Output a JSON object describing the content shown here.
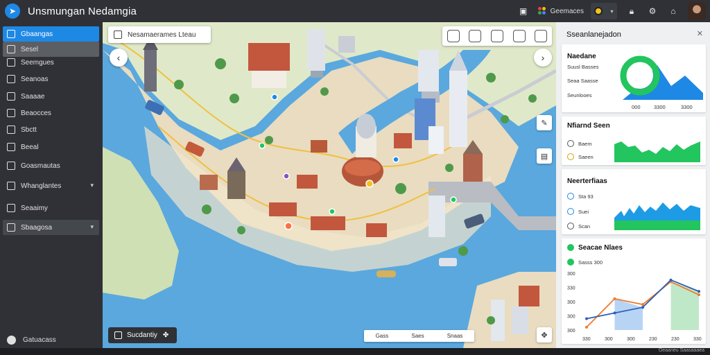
{
  "app": {
    "title": "Unsmungan Nedamgia",
    "brand_label": "Geemaces",
    "colors": {
      "accent": "#1e88e5",
      "green": "#22c55e",
      "water": "#5aa8de",
      "land": "#e9dcc0"
    }
  },
  "sidebar": {
    "items": [
      {
        "label": "Gbaangas",
        "icon": "map-icon"
      },
      {
        "label": "Sesel",
        "icon": "search-icon"
      },
      {
        "label": "Seemgues",
        "icon": "list-icon"
      },
      {
        "label": "Seanoas",
        "icon": "layers-icon"
      },
      {
        "label": "Saaaae",
        "icon": "table-icon"
      },
      {
        "label": "Beaocces",
        "icon": "grid-icon"
      },
      {
        "label": "Sbctt",
        "icon": "chart-icon"
      },
      {
        "label": "Beeal",
        "icon": "document-icon"
      },
      {
        "label": "Goasmautas",
        "icon": "edit-icon"
      },
      {
        "label": "Whanglantes",
        "icon": "folder-icon"
      },
      {
        "label": "Seaaimy",
        "icon": "settings-icon"
      },
      {
        "label": "Sbaagosa",
        "icon": "user-icon"
      }
    ],
    "footer_label": "Gatuacass"
  },
  "map": {
    "search_text": "Nesamaerames Lteau",
    "bottom_left_label": "Sucdantiy",
    "scale_labels": [
      "Gass",
      "Saes",
      "Snaas"
    ]
  },
  "panel": {
    "header_title": "Sseanlanejadon",
    "card1": {
      "title": "Naedane",
      "lines": [
        "Suusl Basses",
        "Seaa Saasse",
        "Seunlooes"
      ],
      "x_labels": [
        "000",
        "3300",
        "3300"
      ]
    },
    "card2": {
      "title": "Nfiarnd Seen",
      "options": [
        "Baem",
        "Saeen"
      ]
    },
    "card3": {
      "title": "Neerterfiaas",
      "options": [
        "Sta 93",
        "Suei",
        "Scan"
      ]
    },
    "card4": {
      "title": "Seacae Nlaes",
      "subtitle": "Sasss 300",
      "y_labels": [
        "300",
        "330",
        "300",
        "300",
        "300"
      ],
      "x_labels": [
        "330",
        "300",
        "300",
        "230",
        "230",
        "330"
      ]
    }
  },
  "footer_text": "Oeaaneu Saasaaaea",
  "chart_data": [
    {
      "type": "line",
      "title": "Seacae Nlaes",
      "series": [
        {
          "values": [
            5,
            55,
            45,
            85,
            62
          ]
        },
        {
          "values": [
            20,
            30,
            40,
            88,
            68
          ]
        }
      ]
    }
  ]
}
